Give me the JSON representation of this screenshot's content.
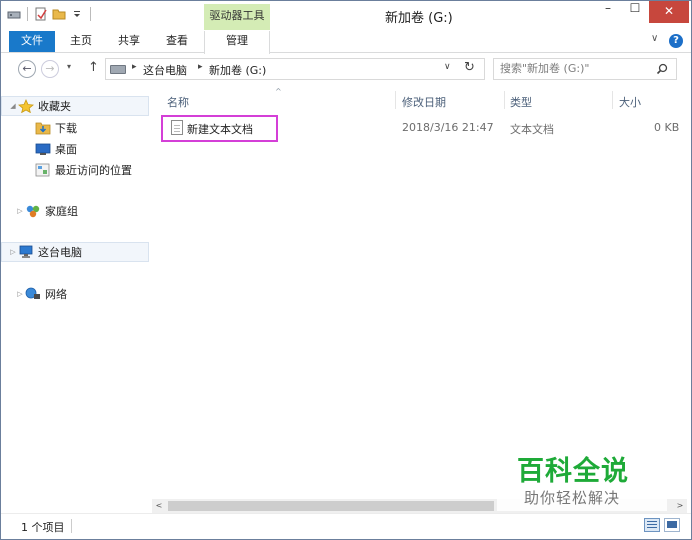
{
  "titlebar": {
    "title": "新加卷 (G:)",
    "contextual_tab": "驱动器工具",
    "minimize": "–",
    "maximize": "☐",
    "close": "✕"
  },
  "ribbon": {
    "tabs": [
      "文件",
      "主页",
      "共享",
      "查看",
      "管理"
    ],
    "expand": "∨",
    "help": "?"
  },
  "address": {
    "back": "←",
    "forward": "→",
    "recent": "▾",
    "up": "↑",
    "crumbs": [
      "这台电脑",
      "新加卷 (G:)"
    ],
    "crumb_separator": "▸",
    "dropdown": "∨",
    "refresh": "↻"
  },
  "search": {
    "placeholder": "搜索\"新加卷 (G:)\""
  },
  "navpane": {
    "expander_closed": "▷",
    "expander_open": "◢",
    "items": [
      {
        "label": "收藏夹",
        "icon": "star-icon"
      },
      {
        "label": "下载",
        "icon": "download-folder-icon"
      },
      {
        "label": "桌面",
        "icon": "desktop-icon"
      },
      {
        "label": "最近访问的位置",
        "icon": "recent-places-icon"
      },
      {
        "label": "家庭组",
        "icon": "homegroup-icon"
      },
      {
        "label": "这台电脑",
        "icon": "computer-icon"
      },
      {
        "label": "网络",
        "icon": "network-icon"
      }
    ]
  },
  "filelist": {
    "columns": [
      "名称",
      "修改日期",
      "类型",
      "大小"
    ],
    "sort_indicator": "^",
    "rows": [
      {
        "name": "新建文本文档",
        "modified": "2018/3/16 21:47",
        "type": "文本文档",
        "size": "0 KB"
      }
    ]
  },
  "scrollbar": {
    "left": "<",
    "right": ">"
  },
  "status": {
    "item_count": "1 个项目"
  },
  "watermark": {
    "title": "百科全说",
    "subtitle": "助你轻松解决"
  },
  "colors": {
    "file_tab": "#1979ca",
    "contextual_tab": "#d4ecb5",
    "close_button": "#c7473d",
    "highlight_box": "#d43fd7",
    "watermark": "#1eaa38"
  }
}
